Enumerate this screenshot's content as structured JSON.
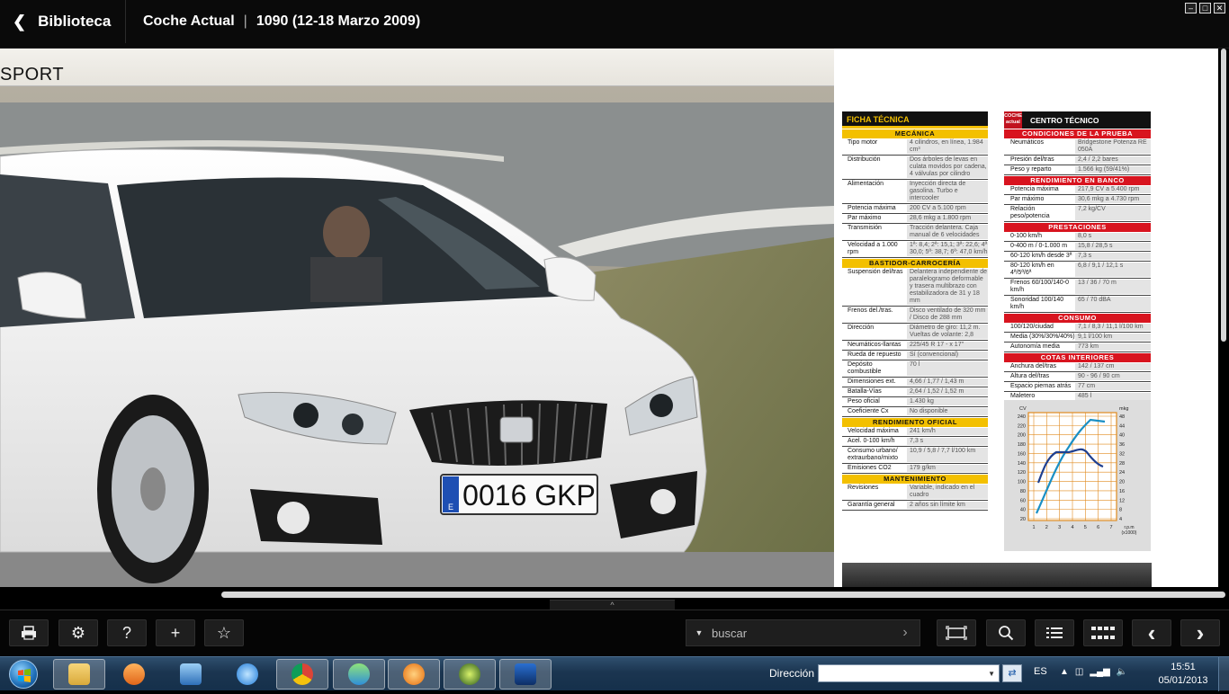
{
  "header": {
    "back_label": "Biblioteca",
    "magazine": "Coche Actual",
    "separator": "|",
    "issue": "1090 (12-18 Marzo 2009)"
  },
  "page": {
    "section_title": "SPORT",
    "plate": "0016 GKP",
    "plate_country": "E"
  },
  "ficha": {
    "title": "FICHA TÉCNICA",
    "sections": [
      {
        "name": "MECÁNICA",
        "rows": [
          [
            "Tipo motor",
            "4 cilindros, en línea, 1.984 cm³"
          ],
          [
            "Distribución",
            "Dos árboles de levas en culata movidos por cadena, 4 válvulas por cilindro"
          ],
          [
            "Alimentación",
            "Inyección directa de gasolina. Turbo e intercooler"
          ],
          [
            "Potencia máxima",
            "200 CV a 5.100 rpm"
          ],
          [
            "Par máximo",
            "28,6 mkg a 1.800 rpm"
          ],
          [
            "Transmisión",
            "Tracción delantera. Caja manual de 6 velocidades"
          ],
          [
            "Velocidad a 1.000 rpm",
            "1ª: 8,4; 2ª: 15,1; 3ª: 22,6; 4ª 30,0; 5ª: 38,7; 6ª: 47,0 km/h"
          ]
        ]
      },
      {
        "name": "BASTIDOR-CARROCERÍA",
        "rows": [
          [
            "Suspensión del/tras",
            "Delantera independiente de paralelogramo deformable y trasera multibrazo con estabilizadora de 31 y 18 mm"
          ],
          [
            "Frenos del./tras.",
            "Disco ventilado de 320 mm / Disco de 288 mm"
          ],
          [
            "Dirección",
            "Diámetro de giro: 11,2 m. Vueltas de volante: 2,8"
          ],
          [
            "Neumáticos-llantas",
            "225/45 R 17 - x 17\""
          ],
          [
            "Rueda de repuesto",
            "Sí (convencional)"
          ],
          [
            "Depósito combustible",
            "70 l"
          ],
          [
            "Dimensiones ext.",
            "4,66 / 1,77 / 1,43 m"
          ],
          [
            "Batalla-Vías",
            "2,64 / 1,52 / 1,52 m"
          ],
          [
            "Peso oficial",
            "1.430 kg"
          ],
          [
            "Coeficiente Cx",
            "No disponible"
          ]
        ]
      },
      {
        "name": "RENDIMIENTO OFICIAL",
        "rows": [
          [
            "Velocidad máxima",
            "241 km/h"
          ],
          [
            "Acel. 0-100 km/h",
            "7,3 s"
          ],
          [
            "Consumo urbano/ extraurbano/mixto",
            "10,9 / 5,8 / 7,7 l/100 km"
          ],
          [
            "Emisiones CO2",
            "179 g/km"
          ]
        ]
      },
      {
        "name": "MANTENIMIENTO",
        "rows": [
          [
            "Revisiones",
            "Variable, indicado en el cuadro"
          ],
          [
            "Garantía general",
            "2 años sin límite km"
          ]
        ]
      }
    ]
  },
  "centro": {
    "logo": "COCHE actual",
    "title": "CENTRO TÉCNICO",
    "sections": [
      {
        "name": "CONDICIONES DE LA PRUEBA",
        "rows": [
          [
            "Neumáticos",
            "Bridgestone Potenza RE 050A"
          ],
          [
            "Presión del/tras",
            "2,4 / 2,2 bares"
          ],
          [
            "Peso y reparto",
            "1.566 kg (59/41%)"
          ]
        ]
      },
      {
        "name": "RENDIMIENTO EN BANCO",
        "rows": [
          [
            "Potencia máxima",
            "217,9 CV a 5.400 rpm"
          ],
          [
            "Par máximo",
            "30,6 mkg a 4.730 rpm"
          ],
          [
            "Relación peso/potencia",
            "7,2 kg/CV"
          ]
        ]
      },
      {
        "name": "PRESTACIONES",
        "rows": [
          [
            "0-100 km/h",
            "8,0 s"
          ],
          [
            "0-400 m / 0-1.000 m",
            "15,8 / 28,5 s"
          ],
          [
            "60-120 km/h desde 3ª",
            "7,3 s"
          ],
          [
            "80-120 km/h en 4ª/5ª/6ª",
            "6,8 / 9,1 / 12,1 s"
          ],
          [
            "Frenos 60/100/140-0 km/h",
            "13 / 36 / 70 m"
          ],
          [
            "Sonoridad 100/140 km/h",
            "65 / 70 dBA"
          ]
        ]
      },
      {
        "name": "CONSUMO",
        "rows": [
          [
            "100/120/ciudad",
            "7,1 / 8,3 / 11,1 l/100 km"
          ],
          [
            "Media (30%/30%/40%)",
            "9,1 l/100 km"
          ],
          [
            "Autonomía media",
            "773 km"
          ]
        ]
      },
      {
        "name": "COTAS INTERIORES",
        "rows": [
          [
            "Anchura del/tras",
            "142 / 137 cm"
          ],
          [
            "Altura del/tras",
            "90 - 96 / 90 cm"
          ],
          [
            "Espacio piernas atrás",
            "77 cm"
          ],
          [
            "Maletero",
            "485 l"
          ]
        ]
      }
    ]
  },
  "graph": {
    "left_unit": "CV",
    "right_unit": "mkg",
    "left_ticks": [
      "240",
      "220",
      "200",
      "180",
      "160",
      "140",
      "120",
      "100",
      "80",
      "60",
      "40",
      "20"
    ],
    "right_ticks": [
      "48",
      "44",
      "40",
      "36",
      "32",
      "28",
      "24",
      "20",
      "16",
      "12",
      "8",
      "4"
    ],
    "x_ticks": [
      "1",
      "2",
      "3",
      "4",
      "5",
      "6",
      "7"
    ],
    "x_unit": "r.p.m",
    "x_unit2": "(x1000)",
    "colors": {
      "power": "#1a8fc4",
      "torque": "#1f3f8f",
      "grid": "#e08a1e"
    }
  },
  "toolbar": {
    "search_placeholder": "buscar",
    "icons": [
      "print-icon",
      "gear-icon",
      "help-icon",
      "plus-icon",
      "star-icon",
      "fit-page-icon",
      "search-icon",
      "list-icon",
      "grid-icon",
      "chevron-left-icon",
      "chevron-right-icon"
    ],
    "help_glyph": "?",
    "plus_glyph": "+",
    "star_glyph": "☆",
    "prev_glyph": "‹",
    "next_glyph": "›",
    "pull_glyph": "^"
  },
  "taskbar": {
    "address_label": "Dirección",
    "language": "ES",
    "time": "15:51",
    "date": "05/01/2013"
  }
}
